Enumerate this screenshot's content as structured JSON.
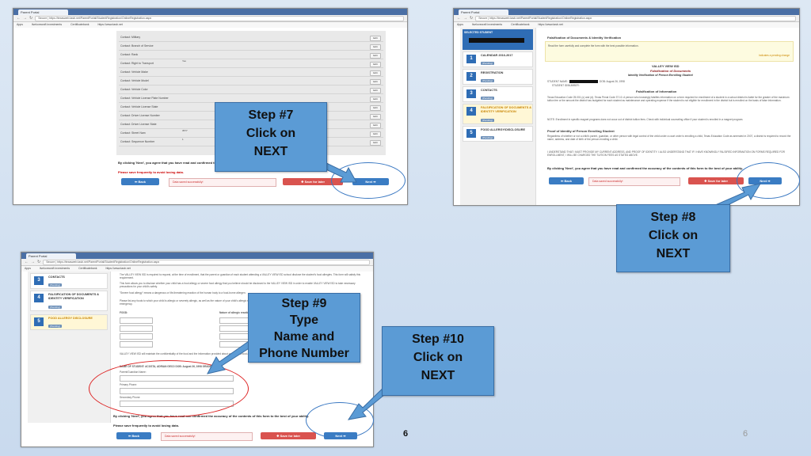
{
  "browser": {
    "tab_title": "Parent Portal - Google Chrome",
    "tab_label": "Parent Portal",
    "url_prefix": "Secure",
    "url": "https://texasweb.tasb.net/ParentPortal/StudentRegistration/OnlineRegistration.aspx",
    "bookmarks": [
      "Apps",
      "livelovecraft investments",
      "Certificatebank",
      "https://www.tasb.net"
    ]
  },
  "shot1": {
    "rows": [
      {
        "label": "Contact: Military",
        "value": ""
      },
      {
        "label": "Contact: Branch of Service",
        "value": ""
      },
      {
        "label": "Contact: Rank",
        "value": ""
      },
      {
        "label": "Contact: Right to Transport",
        "value": "Yes"
      },
      {
        "label": "Contact: Vehicle Make",
        "value": ""
      },
      {
        "label": "Contact: Vehicle Model",
        "value": ""
      },
      {
        "label": "Contact: Vehicle Color",
        "value": ""
      },
      {
        "label": "Contact: Vehicle License Plate Number",
        "value": ""
      },
      {
        "label": "Contact: Vehicle License State",
        "value": ""
      },
      {
        "label": "Contact: Driver License Number",
        "value": ""
      },
      {
        "label": "Contact: Driver License State",
        "value": ""
      },
      {
        "label": "Contact: Street Nam",
        "value": "3577"
      },
      {
        "label": "Contact: Sequence Number",
        "value": "1"
      }
    ],
    "edit_label": "Edit",
    "consent": "By clicking 'Next', you agree that you have read and confirmed the accuracy of the contents of this form to the best of your ability.",
    "warning": "Please save frequently to avoid losing data.",
    "back": "Back",
    "message": "Data saved successfully!",
    "save": "Save for later",
    "next": "Next"
  },
  "shot2": {
    "selected_student": "SELECTED STUDENT",
    "steps": [
      {
        "num": "1",
        "label": "CALENDAR 2016-2017",
        "status": "(Pending)"
      },
      {
        "num": "2",
        "label": "REGISTRATION",
        "status": "(Pending)"
      },
      {
        "num": "3",
        "label": "CONTACTS",
        "status": "(Pending)"
      },
      {
        "num": "4",
        "label": "FALSIFICATION OF DOCUMENTS & IDENTITY VERIFICATION",
        "status": "(Pending)"
      },
      {
        "num": "5",
        "label": "FOOD ALLERGY/DISCLOSURE",
        "status": "(Pending)"
      }
    ],
    "form_title": "Falsification of Documents & Identity Verification",
    "form_instructions": "Read the form carefully and complete the form with the best possible information.",
    "status_note": "Indicates a pending change",
    "district": "VALLEY VIEW ISD",
    "doc_title": "Falsification of Documents",
    "doc_subtitle": "Identity Verification of Person Enrolling Student",
    "student_name_label": "STUDENT NAME:",
    "dob": "DOB: August 26, 1998",
    "student_id_label": "STUDENT ID/NUMBER:",
    "section1": "Falsification of Information",
    "section2": "Proof of Identity of Person Enrolling Student",
    "body1": "Texas Education Code 25.001 (c) and (d). Texas Penal Code 37.10. A person who knowingly falsifies information on a form required for enrollment of a student in a school district is liable for the greater of the maximum tuition fee or the amount the district has budgeted for each student as maintenance and operating expense if the student is not eligible for enrollment in the district but is enrolled on the basis of false information.",
    "body2": "NOTE: Enrollment in specific magnet programs does not occur out of district tuition fees. Check with individual counseling office if your student is enrolled in a magnet program.",
    "body3": "Regardless of whether or not a child's parent, guardian, or other person with legal control of the child under a court order is enrolling a child, Texas Education Code as amended in 2007, a district is required to record the name, address, and date of birth of the person enrolling a child.",
    "body4": "I UNDERSTAND THAT I MUST PROVIDE MY CURRENT ADDRESS, AND PROOF OF IDENTITY. I ALSO UNDERSTAND THAT IF I HAVE KNOWINGLY FALSIFIED INFORMATION ON FORMS REQUIRED FOR ENROLLMENT, I WILL BE CHARGED THE TUITION FEES AS STATED ABOVE.",
    "consent": "By clicking 'Next', you agree that you have read and confirmed the accuracy of the contents of this form to the best of your ability.",
    "back": "Back",
    "message": "Data saved successfully!",
    "save": "Save for later",
    "next": "Next"
  },
  "shot3": {
    "steps": [
      {
        "num": "3",
        "label": "CONTACTS",
        "status": "(Pending)"
      },
      {
        "num": "4",
        "label": "FALSIFICATION OF DOCUMENTS & IDENTITY VERIFICATION",
        "status": "(Pending)"
      },
      {
        "num": "5",
        "label": "FOOD ALLERGY DISCLOSURE",
        "status": "(Pending)"
      }
    ],
    "body1": "The VALLEY VIEW ISD is required to request, at the time of enrollment, that the parent or guardian of each student attending a VALLEY VIEW ISD school disclose the student's food allergies. This form will satisfy this requirement.",
    "body2": "This form allows you to disclose whether your child has a food allergy or severe food allergy that you believe should be disclosed to the VALLEY VIEW ISD in order to enable VALLEY VIEW ISD to take necessary precautions for your child's safety.",
    "body3": "\"Severe food allergy\" means a dangerous or life-threatening reaction of the human body to a food-borne allergen.",
    "body4": "Please list any foods to which your child is allergic or severely allergic, as well as the nature of your child's allergic reaction to the food. The school must have an EpiPen prescribed for students in the event of an emergency.",
    "food_label": "FOOD:",
    "reaction_label": "Nature of allergic reaction to the food:",
    "confidential": "VALLEY VIEW ISD will maintain the confidentiality of the food and the information provided about your child's food allergies.",
    "name_of_student": "NAME OF STUDENT: ACOSTA, ADRIAN GECO    DOB: August 26, 1998    GRADE: 12",
    "guardian_label": "Parent/Guardian Name:",
    "primary_phone": "Primary Phone:",
    "secondary_phone": "Secondary Phone:",
    "consent": "By clicking 'Next', you agree that you have read and confirmed the accuracy of the contents of this form to the best of your ability.",
    "warning": "Please save frequently to avoid losing data.",
    "back": "Back",
    "message": "Data saved successfully!",
    "save": "Save for later",
    "next": "Next"
  },
  "callouts": {
    "step7": [
      "Step #7",
      "Click on",
      "NEXT"
    ],
    "step8": [
      "Step #8",
      "Click on",
      "NEXT"
    ],
    "step9": [
      "Step #9",
      "Type",
      "Name and",
      "Phone Number"
    ],
    "step10": [
      "Step #10",
      "Click on",
      "NEXT"
    ]
  },
  "slide_number": "6",
  "slide_number_faded": "6",
  "colors": {
    "accent": "#5b9bd5",
    "primary_button": "#3a7cc3",
    "danger_button": "#d9534f",
    "highlight_ellipse": "#d22222"
  }
}
